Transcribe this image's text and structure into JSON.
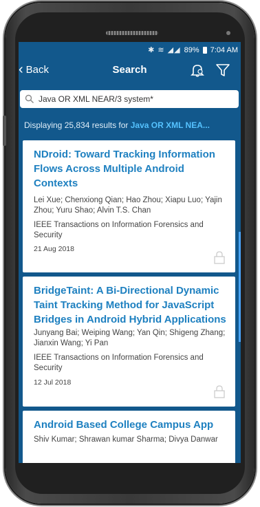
{
  "status": {
    "icons": "✱ ≋ ◢◢",
    "battery": "89%",
    "time": "7:04 AM"
  },
  "nav": {
    "back_label": "Back",
    "title": "Search"
  },
  "search": {
    "value": "Java OR XML NEAR/3 system*"
  },
  "results": {
    "prefix": "Displaying 25,834 results for ",
    "query": "Java OR XML NEA..."
  },
  "articles": [
    {
      "title": "NDroid: Toward Tracking Information Flows Across Multiple Android Contexts",
      "authors": "Lei Xue; Chenxiong Qian; Hao Zhou; Xiapu Luo; Yajin Zhou; Yuru Shao; Alvin T.S. Chan",
      "journal": "IEEE Transactions on Information Forensics and Security",
      "date": "21 Aug 2018"
    },
    {
      "title": "BridgeTaint: A Bi-Directional Dynamic Taint Tracking Method for JavaScript Bridges in Android Hybrid Applications",
      "authors": "Junyang Bai; Weiping Wang; Yan Qin; Shigeng Zhang; Jianxin Wang; Yi Pan",
      "journal": "IEEE Transactions on Information Forensics and Security",
      "date": "12 Jul 2018"
    },
    {
      "title": "Android Based College Campus App",
      "authors": "Shiv Kumar; Shrawan kumar Sharma; Divya Danwar"
    }
  ],
  "colors": {
    "header": "#12588c",
    "title_blue": "#1e80c0",
    "query_blue": "#55c2ff"
  },
  "icons": [
    "bluetooth-icon",
    "wifi-icon",
    "signal-icon",
    "battery-icon",
    "back-chevron-icon",
    "bell-settings-icon",
    "filter-icon",
    "search-icon",
    "lock-icon"
  ]
}
